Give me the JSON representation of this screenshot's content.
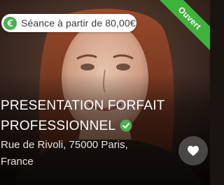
{
  "price_badge": {
    "label": "Séance à partir de 80,00€",
    "icon": "euro-coin-icon"
  },
  "status_ribbon": {
    "label": "Ouvert",
    "color": "#3fb43a"
  },
  "title": {
    "line1": "PRESENTATION FORFAIT",
    "line2": "PROFESSIONNEL",
    "verified_icon": "verified-check-icon"
  },
  "address": {
    "line1": "Rue de Rivoli, 75000 Paris,",
    "line2": "France"
  },
  "favorite": {
    "icon": "heart-icon"
  },
  "colors": {
    "accent_green": "#4caf50",
    "ribbon_green": "#3fb43a"
  }
}
